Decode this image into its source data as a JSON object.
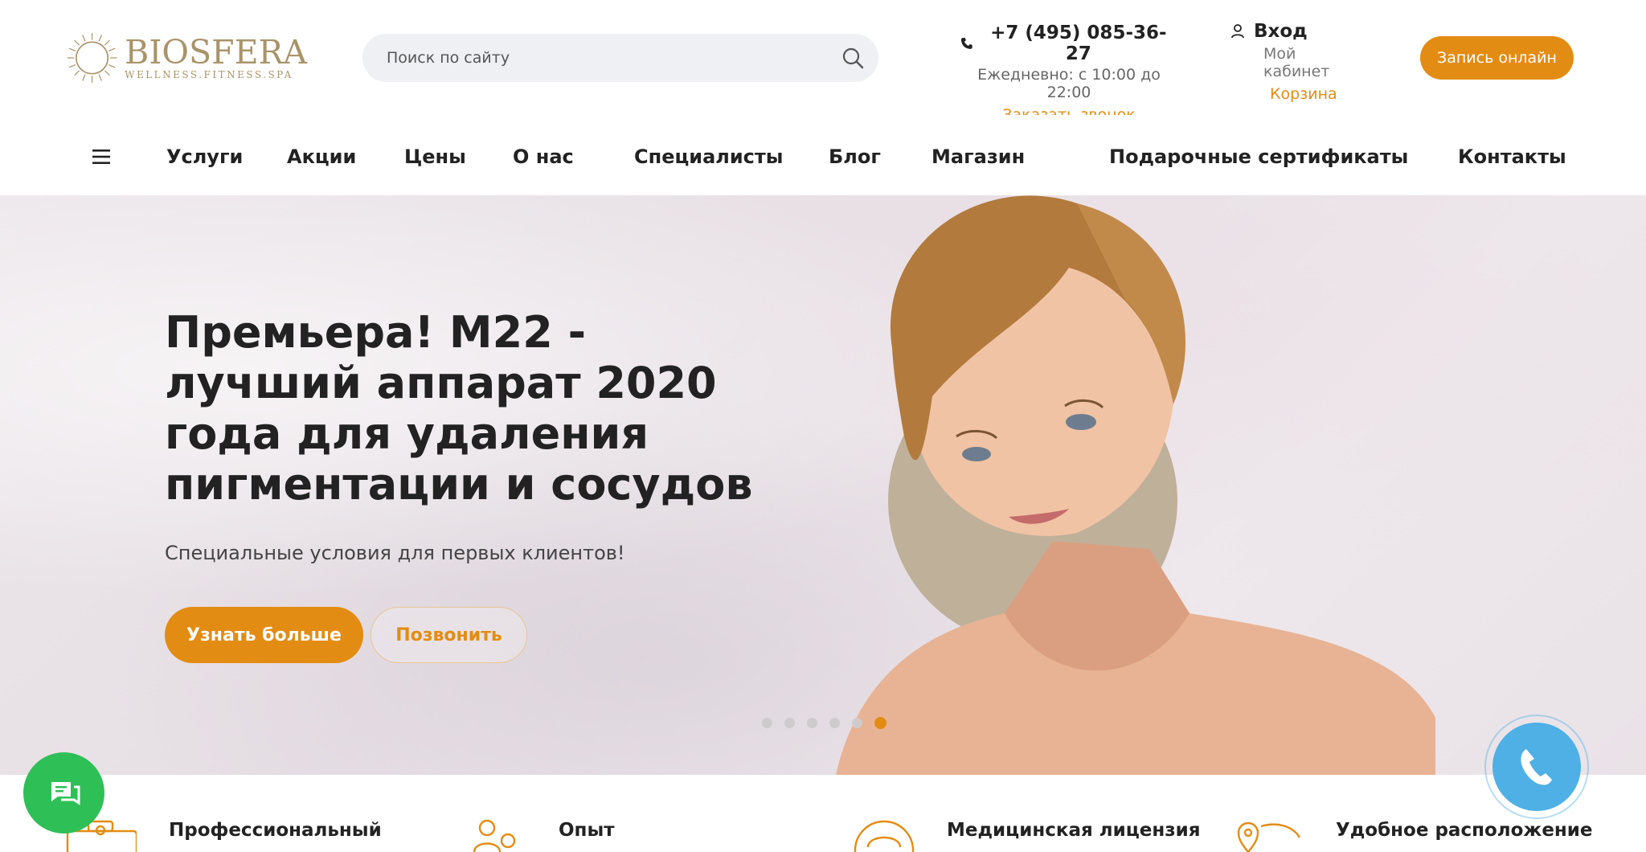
{
  "brand": {
    "name": "BIOSFERA",
    "tagline": "WELLNESS.FITNESS.SPA",
    "accent": "#e38c13",
    "logo_color": "#a8946a"
  },
  "search": {
    "placeholder": "Поиск по сайту",
    "icon": "search-icon"
  },
  "contact": {
    "phone": "+7 (495) 085-36-27",
    "hours": "Ежедневно: с 10:00 до 22:00",
    "callback": "Заказать звонок"
  },
  "account": {
    "login": "Вход",
    "cabinet": "Мой кабинет",
    "cart": "Корзина"
  },
  "header": {
    "book_button": "Запись онлайн"
  },
  "nav": {
    "menu_icon": "hamburger-icon",
    "items": [
      "Услуги",
      "Акции",
      "Цены",
      "О нас",
      "Специалисты",
      "Блог",
      "Магазин",
      "Подарочные сертификаты",
      "Контакты"
    ]
  },
  "hero": {
    "title": "Премьера! М22 - лучший аппарат 2020 года для удаления пигментации и сосудов",
    "subtitle": "Специальные условия для первых клиентов!",
    "primary_button": "Узнать больше",
    "secondary_button": "Позвонить",
    "slides_total": 6,
    "active_slide": 6
  },
  "features": [
    "Профессиональный",
    "Опыт",
    "Медицинская лицензия",
    "Удобное расположение"
  ],
  "widgets": {
    "chat_color": "#2fbf57",
    "call_color": "#4fb0e6"
  }
}
